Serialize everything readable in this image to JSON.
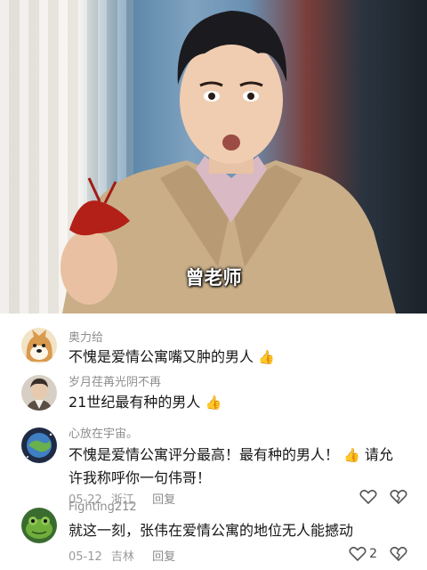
{
  "video": {
    "caption": "曾老师"
  },
  "comments": [
    {
      "username": "奥力给",
      "text": "不愧是爱情公寓嘴又肿的男人",
      "emoji": "thumbs-up"
    },
    {
      "username": "岁月荏苒光阴不再",
      "text": "21世纪最有种的男人",
      "emoji": "thumbs-up"
    },
    {
      "username": "心放在宇宙。",
      "text_part1": "不愧是爱情公寓评分最高！最有种的男人！",
      "text_part2": "请允许我称呼你一句伟哥！",
      "emoji": "thumbs-up",
      "date": "05-22",
      "location": "浙江",
      "reply_label": "回复"
    },
    {
      "username": "Fighting212",
      "text": "就这一刻，张伟在爱情公寓的地位无人能撼动",
      "date": "05-12",
      "location": "吉林",
      "reply_label": "回复",
      "like_count": "2"
    }
  ],
  "colors": {
    "username": "#8e8e8e",
    "comment_text": "#161616",
    "meta": "#9a9a9a",
    "thumb": "#f2b233"
  }
}
